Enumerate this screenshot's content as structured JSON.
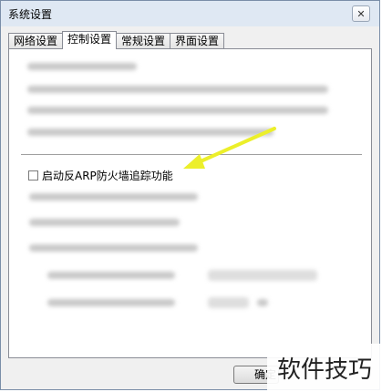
{
  "window": {
    "title": "系统设置",
    "close_glyph": "✕"
  },
  "tabs": [
    {
      "label": "网络设置",
      "active": false
    },
    {
      "label": "控制设置",
      "active": true
    },
    {
      "label": "常规设置",
      "active": false
    },
    {
      "label": "界面设置",
      "active": false
    }
  ],
  "control_settings": {
    "arp_tracking_checkbox": {
      "label": "启动反ARP防火墙追踪功能",
      "checked": false
    }
  },
  "annotation": {
    "arrow_color": "#ecef2a"
  },
  "footer": {
    "ok_label": "确定"
  },
  "watermark": {
    "text": "软件技巧"
  }
}
